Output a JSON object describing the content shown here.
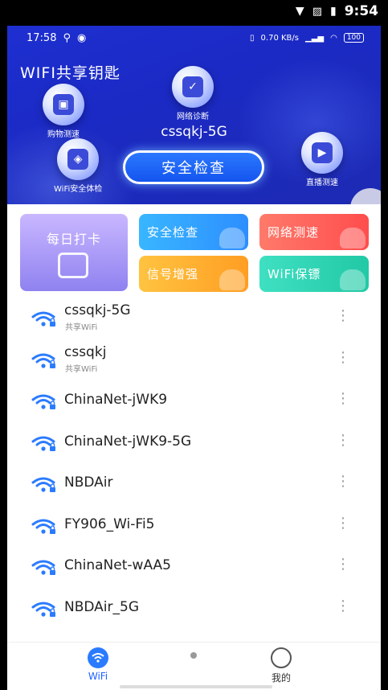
{
  "system_status": {
    "time": "9:54"
  },
  "inner_status": {
    "time": "17:58",
    "speed": "0.70 KB/s",
    "battery": "100"
  },
  "header": {
    "title": "WIFI共享钥匙",
    "ssid": "cssqkj-5G",
    "check_button": "安全检查",
    "orbs": {
      "shopping": "购物测速",
      "diagnose": "网络诊断",
      "security": "WiFi安全体检",
      "live": "直播测速"
    }
  },
  "tools": {
    "daily": "每日打卡",
    "security_check": "安全检查",
    "speed_test": "网络测速",
    "signal_boost": "信号增强",
    "wifi_guard": "WiFi保镖"
  },
  "networks": [
    {
      "name": "cssqkj-5G",
      "sub": "共享WiFi"
    },
    {
      "name": "cssqkj",
      "sub": "共享WiFi"
    },
    {
      "name": "ChinaNet-jWK9",
      "sub": ""
    },
    {
      "name": "ChinaNet-jWK9-5G",
      "sub": ""
    },
    {
      "name": "NBDAir",
      "sub": ""
    },
    {
      "name": "FY906_Wi-Fi5",
      "sub": ""
    },
    {
      "name": "ChinaNet-wAA5",
      "sub": ""
    },
    {
      "name": "NBDAir_5G",
      "sub": ""
    }
  ],
  "more_glyph": "⋮",
  "bottom_nav": {
    "wifi": "WiFi",
    "mine": "我的"
  },
  "colors": {
    "header": "#1e2fd1",
    "accent": "#1c61ff",
    "wifi_icon": "#2b7bff"
  }
}
